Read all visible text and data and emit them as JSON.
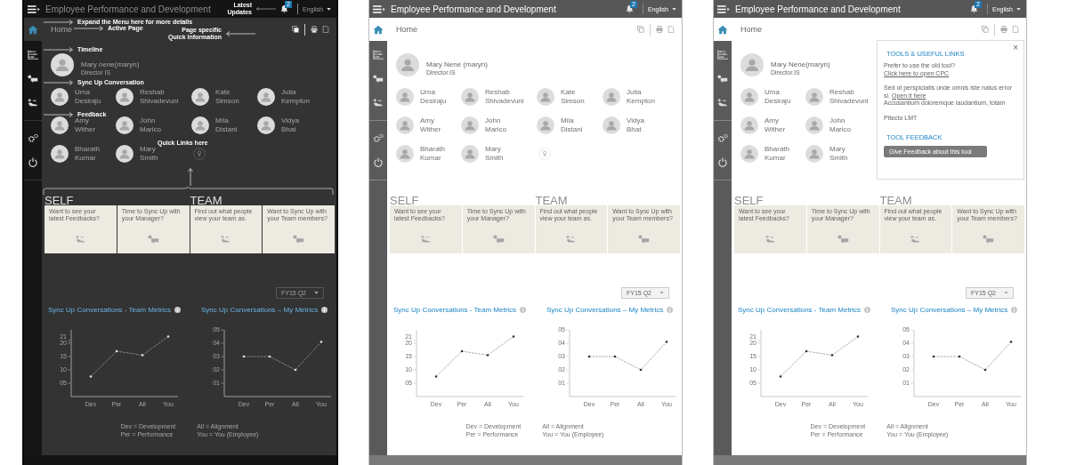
{
  "screens": [
    {
      "kind": "annotated",
      "header": {
        "title": "Employee Performance and Development",
        "notifications": "2",
        "language": "English"
      },
      "page_title": "Home",
      "profile": {
        "name": "Mary nene(maryn)",
        "role": "Director IS"
      },
      "team_rows": [
        [
          {
            "kind": "person",
            "name": "Uma Desiraju"
          },
          {
            "kind": "person",
            "name": "Reshab Shivadevuni"
          },
          {
            "kind": "person",
            "name": "Kate Simson"
          },
          {
            "kind": "person",
            "name": "Julia Kempton"
          }
        ],
        [
          {
            "kind": "person",
            "name": "Amy Wither"
          },
          {
            "kind": "person",
            "name": "John Marico"
          },
          {
            "kind": "person",
            "name": "Mila Distani"
          },
          {
            "kind": "person",
            "name": "Vidya Bhat"
          }
        ],
        [
          {
            "kind": "person",
            "name": "Bharath Kumar"
          },
          {
            "kind": "person",
            "name": "Mary Smith"
          },
          {
            "kind": "add"
          }
        ]
      ],
      "sections": [
        {
          "label": "SELF",
          "cards": [
            {
              "kind": "feedback",
              "text": "Want to see your latest Feedbacks?"
            },
            {
              "kind": "chat",
              "text": "Time to Sync Up with your Manager?"
            }
          ]
        },
        {
          "label": "TEAM",
          "cards": [
            {
              "kind": "feedback",
              "text": "Find out what people view your team as."
            },
            {
              "kind": "chat",
              "text": "Want to Sync Up with your Team members?"
            }
          ]
        }
      ],
      "period": "FY15 Q2",
      "charts": [
        {
          "title": "Sync Up Conversations - Team Metrics",
          "chart_data": {
            "type": "line",
            "categories": [
              "Dev",
              "Per",
              "All",
              "You"
            ],
            "series": [
              {
                "color": "#999999",
                "line_style": "dashed",
                "values": [
                  7.5,
                  17,
                  15.5,
                  22.5
                ]
              }
            ],
            "ylim": [
              0,
              25
            ],
            "yticks": [
              {
                "value": 5,
                "label": "05"
              },
              {
                "value": 10,
                "label": "10"
              },
              {
                "value": 15,
                "label": "15"
              },
              {
                "value": 20,
                "label": "20"
              },
              {
                "value": 21,
                "label": "21"
              }
            ]
          }
        },
        {
          "title": "Sync Up Conversations – My Metrics",
          "chart_data": {
            "type": "line",
            "categories": [
              "Dev",
              "Per",
              "All",
              "You"
            ],
            "series": [
              {
                "color": "#999999",
                "line_style": "dashed",
                "values": [
                  3,
                  3,
                  2,
                  4.1
                ]
              }
            ],
            "ylim": [
              0,
              5
            ],
            "yticks": [
              {
                "value": 1,
                "label": "01"
              },
              {
                "value": 2,
                "label": "02"
              },
              {
                "value": 3,
                "label": "03"
              },
              {
                "value": 4,
                "label": "04"
              },
              {
                "value": 5,
                "label": "05"
              }
            ]
          }
        }
      ],
      "legend": [
        "Dev = Development",
        "All = Alignment",
        "Per = Performance",
        "You = You (Employee)"
      ],
      "annotations": [
        {
          "kind": "menu",
          "text": "Expand the Menu here for more details"
        },
        {
          "kind": "updates",
          "text": "Latest Updates"
        },
        {
          "kind": "page",
          "text": "Active Page"
        },
        {
          "kind": "quick-info",
          "text": "Page specific Quick Information"
        },
        {
          "kind": "timeline",
          "text": "Timeline"
        },
        {
          "kind": "sync",
          "text": "Sync Up Conversation"
        },
        {
          "kind": "feedback",
          "text": "Feedback"
        },
        {
          "kind": "quick-links",
          "text": "Quick Links here"
        }
      ]
    },
    {
      "kind": "plain",
      "header": {
        "title": "Employee Performance and Development",
        "notifications": "2",
        "language": "English"
      },
      "page_title": "Home",
      "profile": {
        "name": "Mary Nene (maryn)",
        "role": "Director.IS"
      },
      "team_rows": [
        [
          {
            "kind": "person",
            "name": "Uma Desiraju"
          },
          {
            "kind": "person",
            "name": "Reshab Shivadevuni"
          },
          {
            "kind": "person",
            "name": "Kate Simson"
          },
          {
            "kind": "person",
            "name": "Julia Kempton"
          }
        ],
        [
          {
            "kind": "person",
            "name": "Amy Wither"
          },
          {
            "kind": "person",
            "name": "John Marico"
          },
          {
            "kind": "person",
            "name": "Mila Distani"
          },
          {
            "kind": "person",
            "name": "Vidya Bhat"
          }
        ],
        [
          {
            "kind": "person",
            "name": "Bharath Kumar"
          },
          {
            "kind": "person",
            "name": "Mary Smith"
          },
          {
            "kind": "add"
          }
        ]
      ],
      "sections": [
        {
          "label": "SELF",
          "cards": [
            {
              "kind": "feedback",
              "text": "Want to see your latest Feedbacks?"
            },
            {
              "kind": "chat",
              "text": "Time to Sync Up with your Manager?"
            }
          ]
        },
        {
          "label": "TEAM",
          "cards": [
            {
              "kind": "feedback",
              "text": "Find out what people view your team as."
            },
            {
              "kind": "chat",
              "text": "Want to Sync Up with your Team members?"
            }
          ]
        }
      ],
      "period": "FY15 Q2",
      "charts": [
        {
          "title": "Sync Up Conversations - Team Metrics",
          "chart_data": {
            "type": "line",
            "categories": [
              "Dev",
              "Per",
              "All",
              "You"
            ],
            "series": [
              {
                "color": "#999999",
                "line_style": "dashed",
                "values": [
                  7.5,
                  17,
                  15.5,
                  22.5
                ]
              }
            ],
            "ylim": [
              0,
              25
            ],
            "yticks": [
              {
                "value": 5,
                "label": "05"
              },
              {
                "value": 10,
                "label": "10"
              },
              {
                "value": 15,
                "label": "15"
              },
              {
                "value": 20,
                "label": "20"
              },
              {
                "value": 21,
                "label": "21"
              }
            ]
          }
        },
        {
          "title": "Sync Up Conversations – My Metrics",
          "chart_data": {
            "type": "line",
            "categories": [
              "Dev",
              "Per",
              "All",
              "You"
            ],
            "series": [
              {
                "color": "#999999",
                "line_style": "dashed",
                "values": [
                  3,
                  3,
                  2,
                  4.1
                ]
              }
            ],
            "ylim": [
              0,
              5
            ],
            "yticks": [
              {
                "value": 1,
                "label": "01"
              },
              {
                "value": 2,
                "label": "02"
              },
              {
                "value": 3,
                "label": "03"
              },
              {
                "value": 4,
                "label": "04"
              },
              {
                "value": 5,
                "label": "05"
              }
            ]
          }
        }
      ],
      "legend": [
        "Dev = Development",
        "All = Alignment",
        "Per = Performance",
        "You = You (Employee)"
      ]
    },
    {
      "kind": "plain",
      "header": {
        "title": "Employee Performance and Development",
        "notifications": "2",
        "language": "English"
      },
      "page_title": "Home",
      "profile": {
        "name": "Mary Nene(maryn)",
        "role": "Director.IS"
      },
      "team_rows": [
        [
          {
            "kind": "person",
            "name": "Uma Desiraju"
          },
          {
            "kind": "person",
            "name": "Reshab Shivadevuni"
          }
        ],
        [
          {
            "kind": "person",
            "name": "Amy Wither"
          },
          {
            "kind": "person",
            "name": "John Marico"
          }
        ],
        [
          {
            "kind": "person",
            "name": "Bharath Kumar"
          },
          {
            "kind": "person",
            "name": "Mary Smith"
          }
        ]
      ],
      "sections": [
        {
          "label": "SELF",
          "cards": [
            {
              "kind": "feedback",
              "text": "Want to see your latest Feedbacks?"
            },
            {
              "kind": "chat",
              "text": "Time to Sync Up with your Manager?"
            }
          ]
        },
        {
          "label": "TEAM",
          "cards": [
            {
              "kind": "feedback",
              "text": "Find out what people view your team as."
            },
            {
              "kind": "chat",
              "text": "Want to Sync Up with your Team members?"
            }
          ]
        }
      ],
      "period": "FY15 Q2",
      "charts": [
        {
          "title": "Sync Up Conversations - Team Metrics",
          "chart_data": {
            "type": "line",
            "categories": [
              "Dev",
              "Per",
              "All",
              "You"
            ],
            "series": [
              {
                "color": "#999999",
                "line_style": "dashed",
                "values": [
                  7.5,
                  17,
                  15.5,
                  22.5
                ]
              }
            ],
            "ylim": [
              0,
              25
            ],
            "yticks": [
              {
                "value": 5,
                "label": "05"
              },
              {
                "value": 10,
                "label": "10"
              },
              {
                "value": 15,
                "label": "15"
              },
              {
                "value": 20,
                "label": "20"
              },
              {
                "value": 21,
                "label": "21"
              }
            ]
          }
        },
        {
          "title": "Sync Up Conversations – My Metrics",
          "chart_data": {
            "type": "line",
            "categories": [
              "Dev",
              "Per",
              "All",
              "You"
            ],
            "series": [
              {
                "color": "#999999",
                "line_style": "dashed",
                "values": [
                  3,
                  3,
                  2,
                  4.1
                ]
              }
            ],
            "ylim": [
              0,
              5
            ],
            "yticks": [
              {
                "value": 1,
                "label": "01"
              },
              {
                "value": 2,
                "label": "02"
              },
              {
                "value": 3,
                "label": "03"
              },
              {
                "value": 4,
                "label": "04"
              },
              {
                "value": 5,
                "label": "05"
              }
            ]
          }
        }
      ],
      "legend": [
        "Dev = Development",
        "All = Alignment",
        "Per = Performance",
        "You = You (Employee)"
      ],
      "popup": {
        "close": "×",
        "title": "TOOLS & USEFUL LINKS",
        "paragraphs": [
          {
            "text": "Prefer to use the old tool? ",
            "link": "Click here to open CPC"
          },
          {
            "text": "Sed ut perspiciatis unde omnis iste natus error si. ",
            "link": "Open it here",
            "after": "Accusantium doloremque laudantium, totam"
          },
          {
            "text": "Pitecto LMT"
          }
        ],
        "feedback_title": "TOOL FEEDBACK",
        "feedback_button": "Give Feedback about this tool"
      }
    }
  ]
}
